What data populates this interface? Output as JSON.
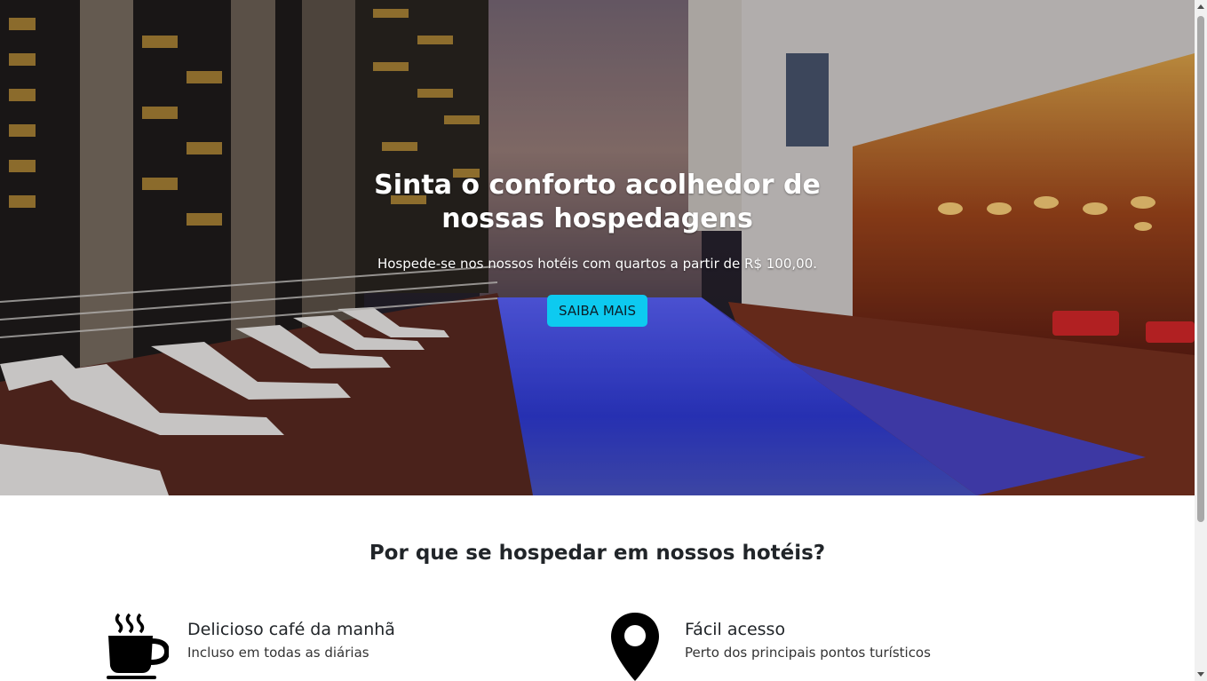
{
  "hero": {
    "title": "Sinta o conforto acolhedor de nossas hospedagens",
    "subtitle": "Hospede-se nos nossos hotéis com quartos a partir de R$ 100,00.",
    "button_label": "SAIBA MAIS"
  },
  "features": {
    "title": "Por que se hospedar em nossos hotéis?",
    "items": [
      {
        "icon": "coffee-cup-icon",
        "heading": "Delicioso café da manhã",
        "description": "Incluso em todas as diárias"
      },
      {
        "icon": "map-pin-icon",
        "heading": "Fácil acesso",
        "description": "Perto dos principais pontos turísticos"
      }
    ]
  },
  "colors": {
    "button": "#0dcaf0",
    "text": "#212529",
    "pool": "#2f3bd9"
  }
}
